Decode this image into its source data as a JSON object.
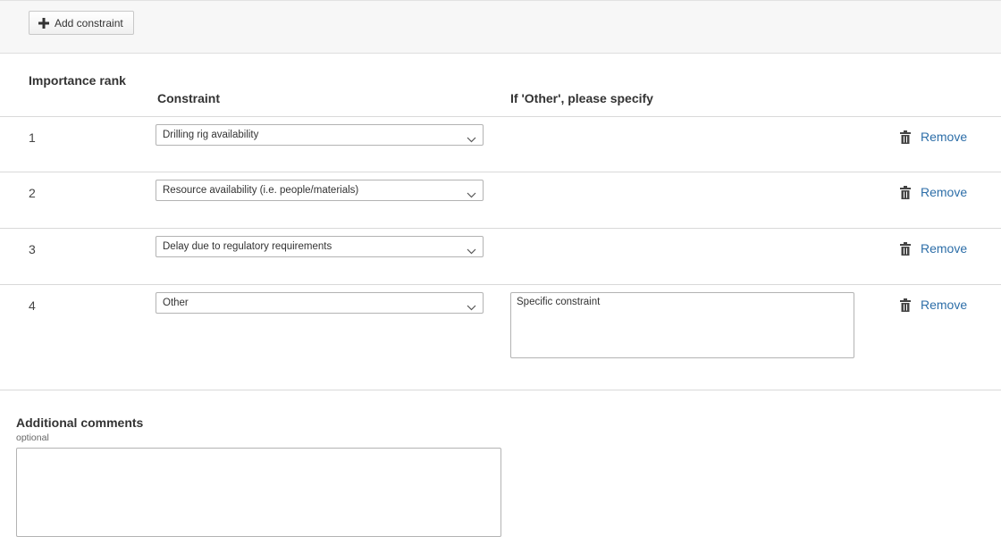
{
  "toolbar": {
    "add_constraint_label": "Add constraint",
    "add_icon": "plus-icon"
  },
  "table": {
    "headers": {
      "rank": "Importance rank",
      "constraint": "Constraint",
      "other": "If 'Other', please specify"
    },
    "rows": [
      {
        "rank": "1",
        "constraint": "Drilling rig availability",
        "specify": null,
        "remove_label": "Remove"
      },
      {
        "rank": "2",
        "constraint": "Resource availability (i.e. people/materials)",
        "specify": null,
        "remove_label": "Remove"
      },
      {
        "rank": "3",
        "constraint": "Delay due to regulatory requirements",
        "specify": null,
        "remove_label": "Remove"
      },
      {
        "rank": "4",
        "constraint": "Other",
        "specify": "Specific constraint",
        "remove_label": "Remove"
      }
    ]
  },
  "comments": {
    "label": "Additional comments",
    "hint": "optional",
    "value": ""
  },
  "colors": {
    "link": "#2d6ea8",
    "toolbar_bg": "#f7f7f7",
    "border": "#b3b3b3"
  }
}
